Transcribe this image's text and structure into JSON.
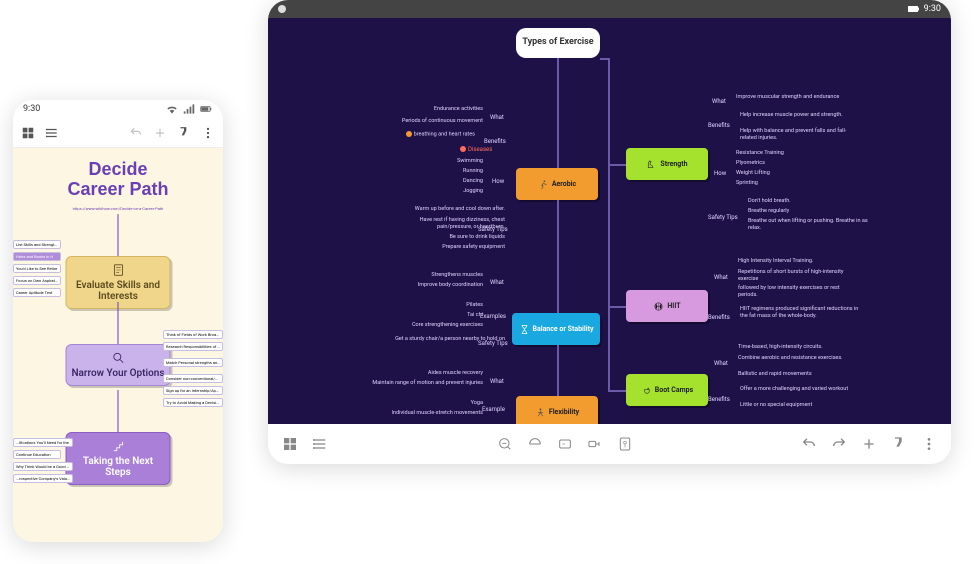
{
  "phone": {
    "status_time": "9:30",
    "title_line1": "Decide",
    "title_line2": "Career Path",
    "url": "https://www.wikihow.com/Decide-on-a-Career-Path",
    "node1": "Evaluate Skills and Interests",
    "node2": "Narrow Your Options",
    "node3": "Taking the Next Steps",
    "chips_left1": [
      "List Skills and Strengths",
      "Hobs and Books in It",
      "You'd Like to See Retire",
      "Focus on Own Aspiration",
      "Career Aptitude Test"
    ],
    "chips_right2": [
      "Think of Fields of Work Broadly",
      "Research Responsibilities of Jobs within the Field",
      "Match Personal strengths and Potential Jobs",
      "Consider non-conventional/Creative",
      "Sign up for an Internship/Apprent",
      "Try to Avoid Making a Decision Based on Money"
    ],
    "chips_left3": [
      "...ifications You'll Need for the",
      "Continue Education",
      "Why Think Would be a Good Fit",
      "...rospective Company's Values on Own"
    ]
  },
  "tablet": {
    "status_time": "9:30",
    "root": "Types of Exercise",
    "categories": {
      "aerobic": "Aerobic",
      "balance": "Balance or Stability",
      "flexibility": "Flexibility",
      "strength": "Strength",
      "hiit": "HIIT",
      "bootcamps": "Boot Camps"
    },
    "groups": {
      "what": "What",
      "benefits": "Benefits",
      "diseases": "Diseases",
      "how": "How",
      "safety": "Safety Tips",
      "example": "Example",
      "examples": "Examples"
    },
    "aerobic": {
      "what": [
        "Endurance activities",
        "Periods of continuous movement"
      ],
      "benefit_marker": "breathing and heart rates",
      "how": [
        "Swimming",
        "Running",
        "Dancing",
        "Jogging"
      ],
      "safety": [
        "Warm up before and cool down after.",
        "Have rest if having dizziness, chest pain/pressure, or heartburn.",
        "Be sure to drink liquids",
        "Prepare safety equipment"
      ]
    },
    "balance": {
      "what": [
        "Strengthens muscles",
        "Improve body coordination"
      ],
      "examples": [
        "Pilates",
        "Tai chi",
        "Core strengthening exercises"
      ],
      "safety": [
        "Get a sturdy chair/a person nearby to hold on"
      ]
    },
    "flexibility": {
      "what": [
        "Aides muscle recovery",
        "Maintain range of motion and prevent injuries"
      ],
      "example": [
        "Yoga",
        "Individual muscle-stretch movements"
      ]
    },
    "strength": {
      "what": [
        "Improve muscular strength and endurance"
      ],
      "benefits": [
        "Help increase muscle power and strength.",
        "Help with balance and prevent falls and fall-related injuries."
      ],
      "how": [
        "Resistance Training",
        "Plyometrics",
        "Weight Lifting",
        "Sprinting"
      ],
      "safety": [
        "Don't hold breath.",
        "Breathe regularly",
        "Breathe out when lifting or pushing. Breathe in as relax."
      ]
    },
    "hiit": {
      "what": [
        "High Intensity Interval Training.",
        "Repetitions of short bursts of high-intensity exercise",
        "followed by low intensity exercises or rest periods."
      ],
      "benefits": [
        "HIIT regimens produced significant reductions in the fat mass of the whole-body."
      ]
    },
    "bootcamps": {
      "what": [
        "Time-based, high-intensity circuits.",
        "Combine aerobic and resistance exercises.",
        "Ballistic and rapid movements"
      ],
      "benefits": [
        "Offer a more challenging and varied workout",
        "Little or no special equipment"
      ]
    },
    "colors": {
      "aerobic": "#f29b2e",
      "balance": "#1aa8e0",
      "flexibility": "#f29b2e",
      "strength": "#a4e22e",
      "hiit": "#d89ade",
      "bootcamps": "#a4e22e"
    }
  }
}
